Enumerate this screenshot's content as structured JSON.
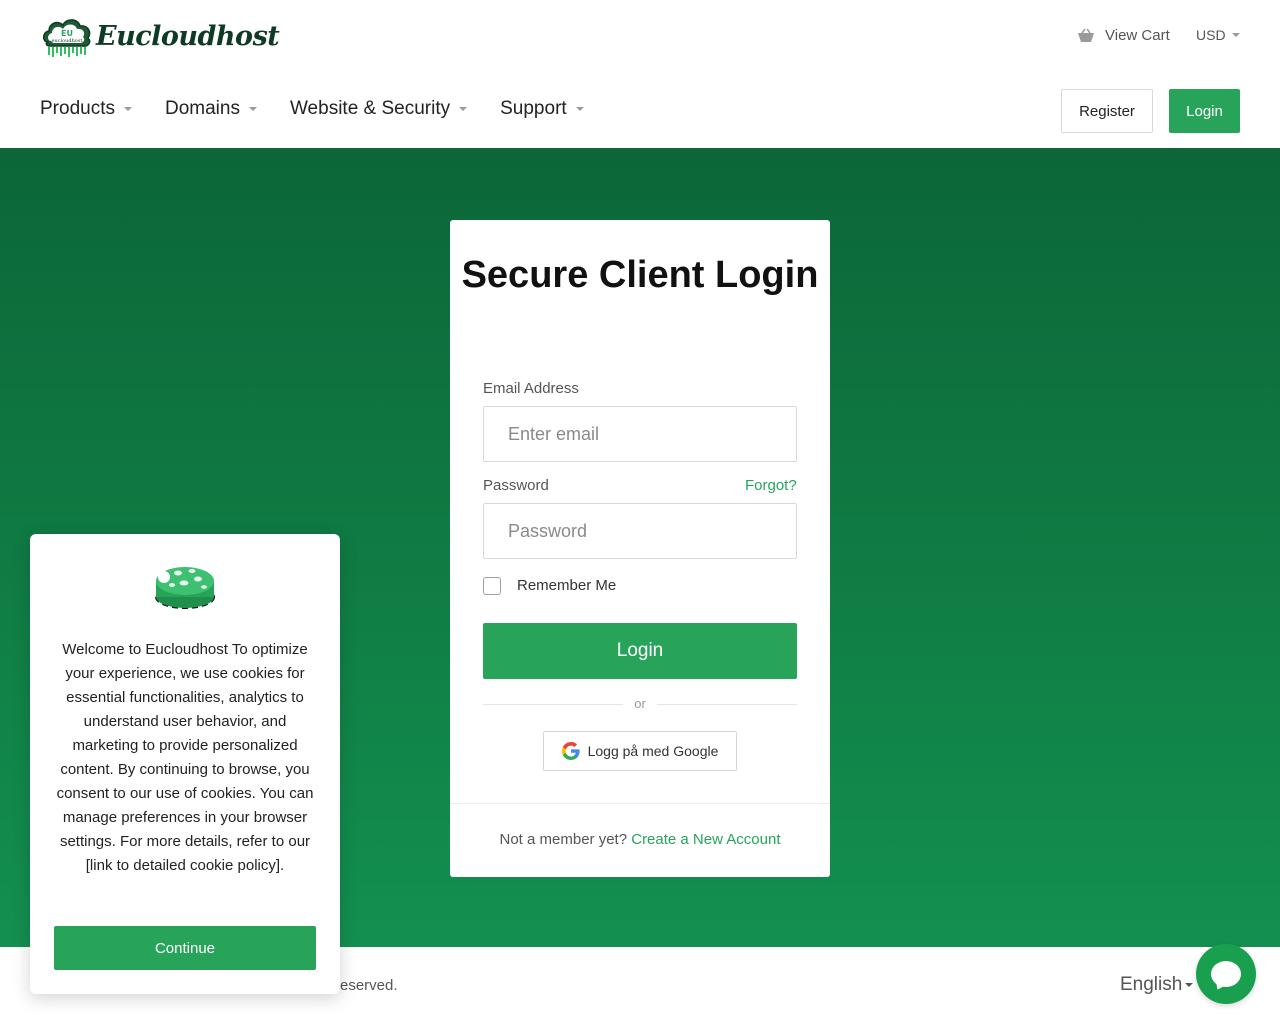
{
  "brand": {
    "name": "Eucloudhost",
    "logo_text": "eucloudhost",
    "logo_mark_text": "EU"
  },
  "header": {
    "cart_label": "View Cart",
    "currency": "USD",
    "register_label": "Register",
    "login_label": "Login"
  },
  "nav": {
    "items": [
      {
        "label": "Products"
      },
      {
        "label": "Domains"
      },
      {
        "label": "Website & Security"
      },
      {
        "label": "Support"
      }
    ]
  },
  "login": {
    "title": "Secure Client Login",
    "email_label": "Email Address",
    "email_placeholder": "Enter email",
    "password_label": "Password",
    "password_placeholder": "Password",
    "forgot_label": "Forgot?",
    "remember_label": "Remember Me",
    "submit_label": "Login",
    "or_label": "or",
    "google_label": "Logg på med Google",
    "member_text": "Not a member yet?",
    "create_account_label": "Create a New Account"
  },
  "cookie": {
    "text": "Welcome to Eucloudhost To optimize your experience, we use cookies for essential functionalities, analytics to understand user behavior, and marketing to provide personalized content. By continuing to browse, you consent to our use of cookies. You can manage preferences in your browser settings. For more details, refer to our [link to detailed cookie policy].",
    "continue_label": "Continue"
  },
  "footer": {
    "copyright_visible": "eserved.",
    "language": "English"
  },
  "colors": {
    "accent": "#27a45a",
    "hero_top": "#0c6638",
    "hero_bottom": "#13904f",
    "brand_dark": "#0f3a24"
  }
}
